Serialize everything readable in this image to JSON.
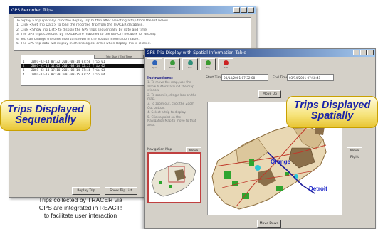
{
  "trips_window": {
    "title": "GPS Recorded Trips",
    "instructions": [
      "To replay a trip spatially: click the Replay Trip button after selecting a trip from the list below.",
      "1. Click <Get Trip Data> to load the recorded trip from the TRACER database.",
      "2. Click <Show Trip List> to display the GPS trips sequentially by date and time.",
      "3. The GPS trips collected by TRACER are matched to the REACT! network for display.",
      "4. You can change the time interval shown in the Spatial Information Table.",
      "5. The GPS trip data will display in chronological order when Replay Trip is clicked."
    ],
    "grid_header": "Trip Start / End Time",
    "trip_rows": [
      {
        "num": "1",
        "text": "2001-03-14 07:32  2001-03-14 07:58  Trip 01"
      },
      {
        "num": "2",
        "text": "2001-03-14 12:05  2001-03-14 12:21  Trip 02"
      },
      {
        "num": "3",
        "text": "2001-03-14 17:10  2001-03-14 17:46  Trip 03"
      },
      {
        "num": "4",
        "text": "2001-03-15 07:29  2001-03-15 07:55  Trip 04"
      }
    ],
    "buttons": {
      "replay": "Replay Trip",
      "show_list": "Show Trip List"
    }
  },
  "spatial_window": {
    "title": "GPS Trip Display with Spatial Information Table",
    "toolbar": [
      {
        "label": "Open",
        "color": "#2c62b8",
        "icon": "folder-icon"
      },
      {
        "label": "Zoom",
        "color": "#3b9a3b",
        "icon": "zoom-icon"
      },
      {
        "label": "Pan",
        "color": "#2f8f7a",
        "icon": "pan-icon"
      },
      {
        "label": "Play",
        "color": "#3a9a2e",
        "icon": "play-icon"
      },
      {
        "label": "Exit",
        "color": "#cc2222",
        "icon": "exit-icon"
      }
    ],
    "instructions_title": "Instructions:",
    "instructions": [
      "1. To move the map, use the arrow buttons around the map window.",
      "2. To zoom in, drag a box on the map.",
      "3. To zoom out, click the Zoom Out button.",
      "4. Select a trip to display.",
      "5. Click a point on the Navigation Map to move to that area."
    ],
    "start_time_label": "Start Time",
    "start_time_value": "03/14/2001 07:32:08",
    "end_time_label": "End Time",
    "end_time_value": "03/14/2001 07:58:41",
    "move_up": "Move Up",
    "move_left": "Move Left",
    "move_right": "Move Right",
    "move_down": "Move Down",
    "navigation_map_label": "Navigation Map",
    "map_labels": {
      "city_a": "Orange",
      "city_b": "Detroit"
    }
  },
  "callouts": {
    "sequential": [
      "Trips Displayed",
      "Sequentially"
    ],
    "spatial": [
      "Trips Displayed",
      "Spatially"
    ]
  },
  "caption": [
    "Trips collected by TRACER via",
    "GPS are integrated in REACT!",
    "to facilitate user interaction"
  ]
}
